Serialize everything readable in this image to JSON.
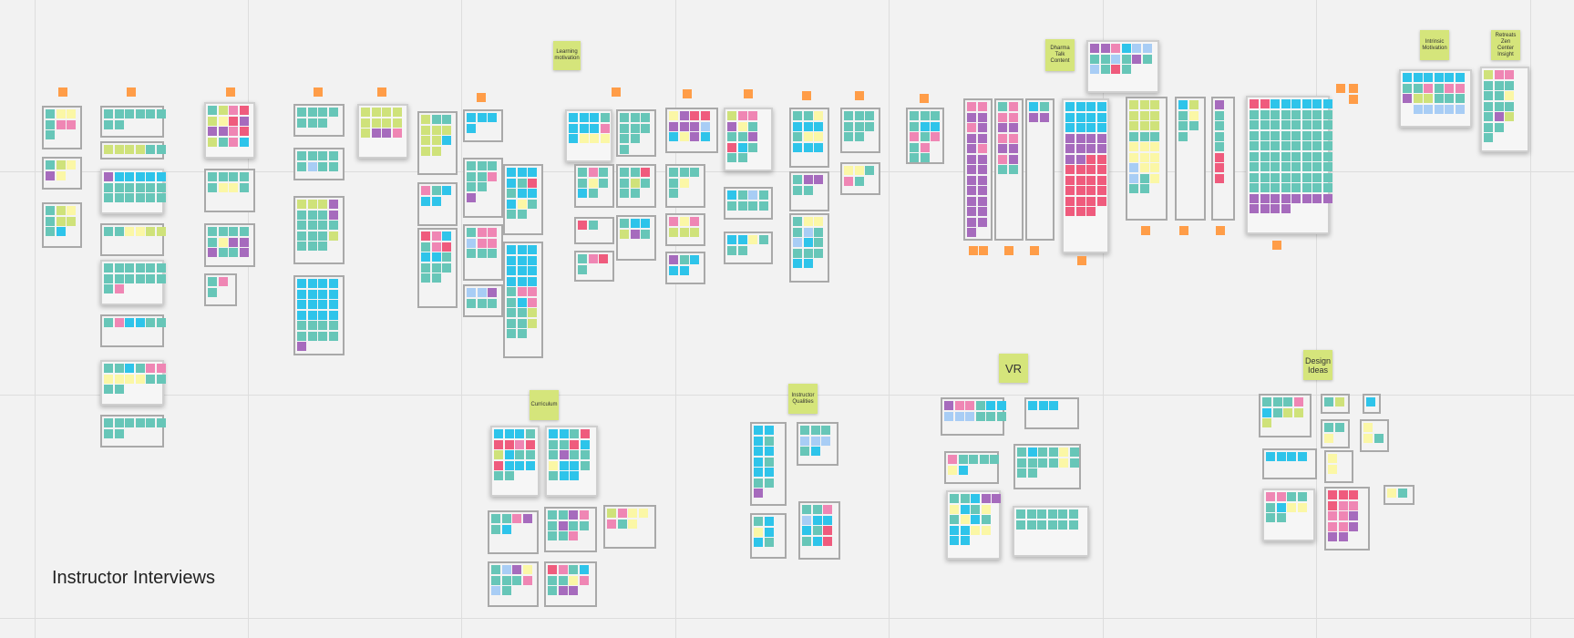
{
  "board": {
    "title": "Instructor Interviews"
  },
  "labels": {
    "learning_motivation": "Learning motivation",
    "dharma_talk_content": "Dharma Talk Content",
    "curriculum": "Curriculum",
    "instructor_qualities": "Instructor Qualities",
    "vr": "VR",
    "design_ideas": "Design Ideas",
    "top_right_1": "Intrinsic Motivation",
    "top_right_2": "Retreats Zen Center Insight"
  },
  "colors": {
    "background": "#f2f2f2",
    "grid": "#dddddd",
    "frame_border": "#a9a9a9",
    "tag_orange": "#ff9d48",
    "label_green": "#d5e57b",
    "note_palette": {
      "c": "#2ec4ea",
      "t": "#67c6b8",
      "y": "#fbf7a6",
      "p": "#ef86b4",
      "v": "#a66bbd",
      "r": "#ef5b7d",
      "l": "#cfe27a",
      "b": "#a8cdf5"
    }
  }
}
